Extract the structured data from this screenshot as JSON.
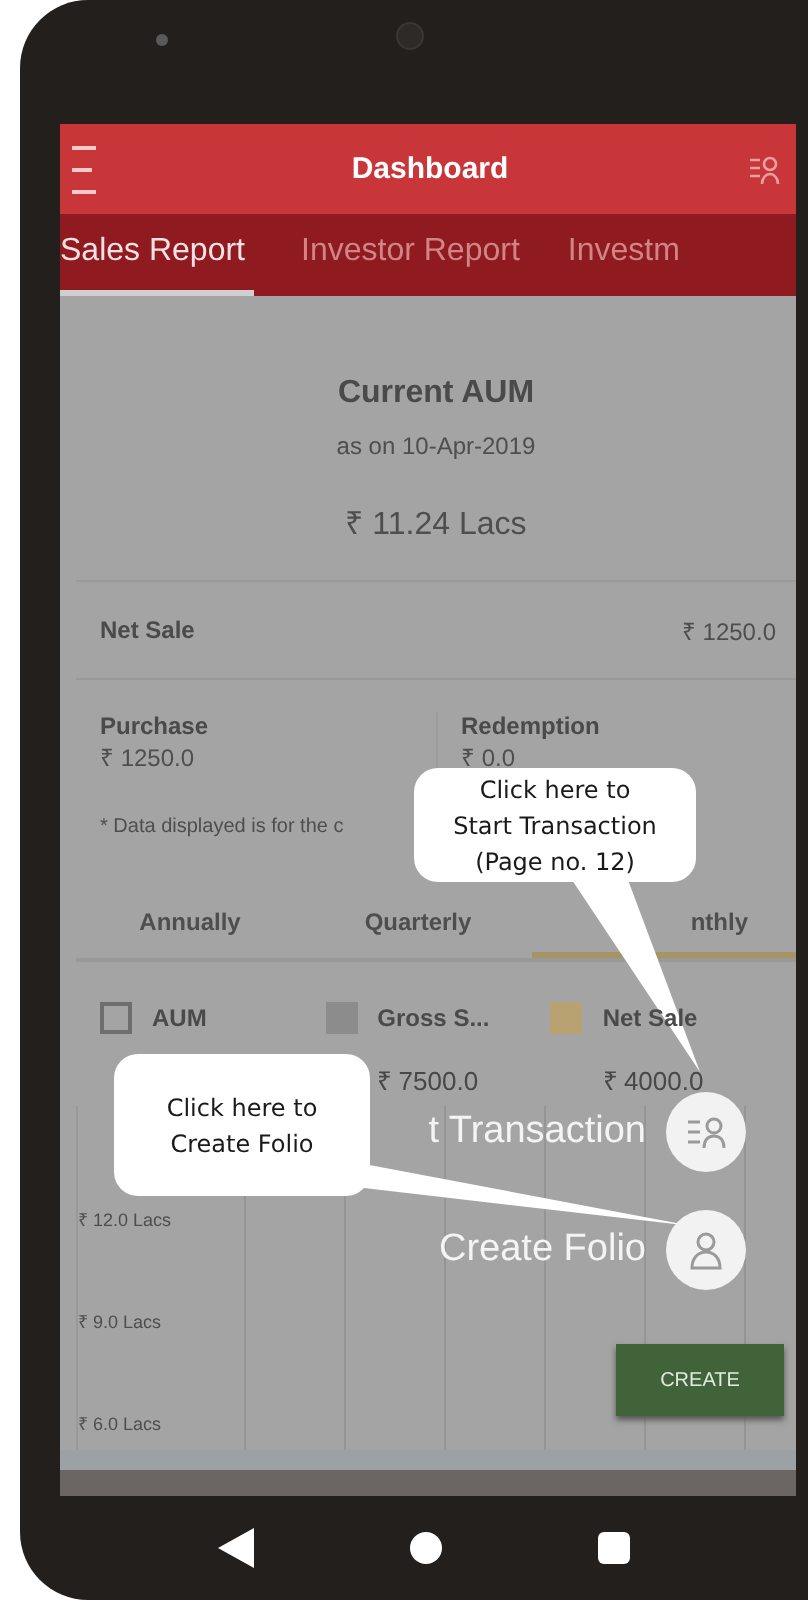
{
  "app_bar": {
    "title": "Dashboard"
  },
  "report_tabs": [
    {
      "label": "Sales Report",
      "selected": true
    },
    {
      "label": "Investor Report",
      "selected": false
    },
    {
      "label": "Investm",
      "selected": false
    }
  ],
  "aum": {
    "title": "Current AUM",
    "date": "as on 10-Apr-2019",
    "amount": "₹ 11.24 Lacs"
  },
  "net_sale": {
    "label": "Net Sale",
    "value": "₹ 1250.0"
  },
  "breakdown": [
    {
      "label": "Purchase",
      "value": "₹ 1250.0"
    },
    {
      "label": "Redemption",
      "value": "₹ 0.0"
    }
  ],
  "note": "* Data displayed is for the c",
  "periods": [
    {
      "label": "Annually",
      "selected": false
    },
    {
      "label": "Quarterly",
      "selected": false
    },
    {
      "label": "nthly",
      "selected": true
    }
  ],
  "legend": [
    {
      "label": "AUM",
      "kind": "hollow",
      "color": "#6e6e6e"
    },
    {
      "label": "Gross S...",
      "kind": "filled",
      "color": "#8c8c8c",
      "value": "₹ 7500.0"
    },
    {
      "label": "Net Sale",
      "kind": "filled",
      "color": "#b8a271",
      "value": "₹ 4000.0"
    }
  ],
  "y_axis_labels": [
    "₹ 12.0 Lacs",
    "₹ 9.0 Lacs",
    "₹ 6.0 Lacs"
  ],
  "actions": [
    {
      "label": "t Transaction",
      "kind": "transaction"
    },
    {
      "label": "Create Folio",
      "kind": "person"
    }
  ],
  "create_button": "CREATE",
  "callouts": [
    {
      "text": "Click here to\nStart Transaction\n(Page no. 12)"
    },
    {
      "text": "Click here to\nCreate Folio"
    }
  ]
}
